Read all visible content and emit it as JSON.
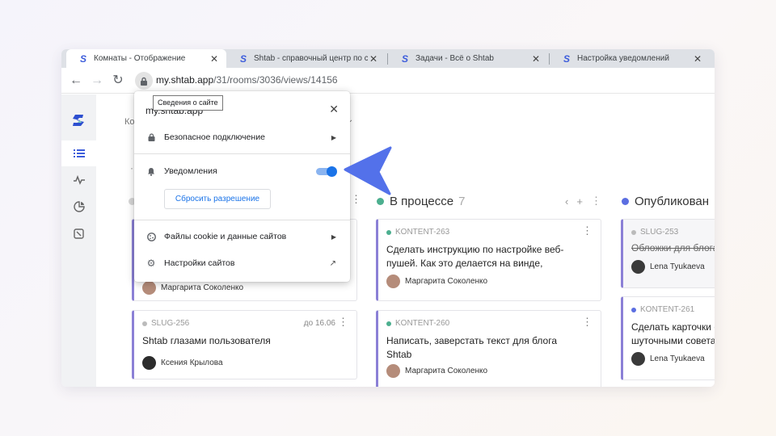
{
  "browser": {
    "tabs": [
      {
        "title": "Комнаты - Отображение",
        "close": "✕"
      },
      {
        "title": "Shtab - справочный центр по с",
        "close": "✕"
      },
      {
        "title": "Задачи - Всё о Shtab",
        "close": "✕"
      },
      {
        "title": "Настройка уведомлений",
        "close": "✕"
      }
    ],
    "url_host": "my.shtab.app",
    "url_path": "/31/rooms/3036/views/14156",
    "tooltip": "Сведения о сайте"
  },
  "site_popup": {
    "site_name": "my.shtab.app",
    "connection": "Безопасное подключение",
    "notifications": "Уведомления",
    "notifications_enabled": true,
    "reset_button": "Сбросить разрешение",
    "cookies": "Файлы cookie и данные сайтов",
    "site_settings": "Настройки сайтов"
  },
  "app": {
    "breadcrumb_prefix": "Ко",
    "columns": [
      {
        "title": "В процессе",
        "count": "7",
        "dot_color": "#4caf8f"
      },
      {
        "title": "Опубликован",
        "count": "",
        "dot_color": "#5b6ee1"
      }
    ],
    "col1_cards": [
      {
        "author": "Маргарита Соколенко"
      },
      {
        "tag": "SLUG-256",
        "tag_color": "#bbbbbb",
        "due": "до 16.06",
        "title": "Shtab глазами пользователя",
        "author": "Ксения Крылова"
      }
    ],
    "col2_cards": [
      {
        "tag": "KONTENT-263",
        "tag_color": "#4caf8f",
        "title": "Сделать инструкцию по настройке веб-пушей. Как это делается на винде,",
        "author": "Маргарита Соколенко"
      },
      {
        "tag": "KONTENT-260",
        "tag_color": "#4caf8f",
        "title": "Написать, заверстать текст для блога Shtab",
        "author": "Маргарита Соколенко"
      }
    ],
    "col3_cards": [
      {
        "tag": "SLUG-253",
        "tag_color": "#bbbbbb",
        "title": "Обложки для блога",
        "author": "Lena Tyukaeva"
      },
      {
        "tag": "KONTENT-261",
        "tag_color": "#5b6ee1",
        "title": "Сделать карточки с шуточными советами",
        "author": "Lena Tyukaeva"
      }
    ]
  }
}
